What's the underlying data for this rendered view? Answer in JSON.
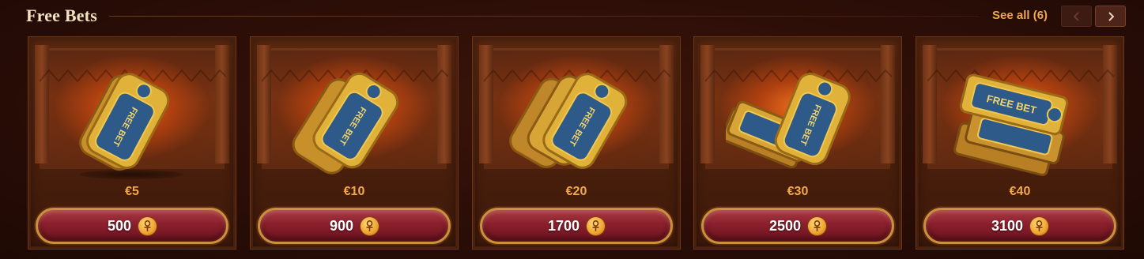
{
  "header": {
    "title": "Free Bets",
    "see_all": "See all (6)"
  },
  "colors": {
    "accent": "#f0a94a",
    "button": "#8a1f2c",
    "gold": "#d9a53c"
  },
  "cards": [
    {
      "price": "€5",
      "cost": "500",
      "ticket_label": "FREE BET"
    },
    {
      "price": "€10",
      "cost": "900",
      "ticket_label": "FREE BET"
    },
    {
      "price": "€20",
      "cost": "1700",
      "ticket_label": "FREE BET"
    },
    {
      "price": "€30",
      "cost": "2500",
      "ticket_label": "FREE BET"
    },
    {
      "price": "€40",
      "cost": "3100",
      "ticket_label": "FREE BET"
    }
  ],
  "icons": {
    "prev": "chevron-left-icon",
    "next": "chevron-right-icon",
    "currency": "ankh-coin-icon"
  }
}
